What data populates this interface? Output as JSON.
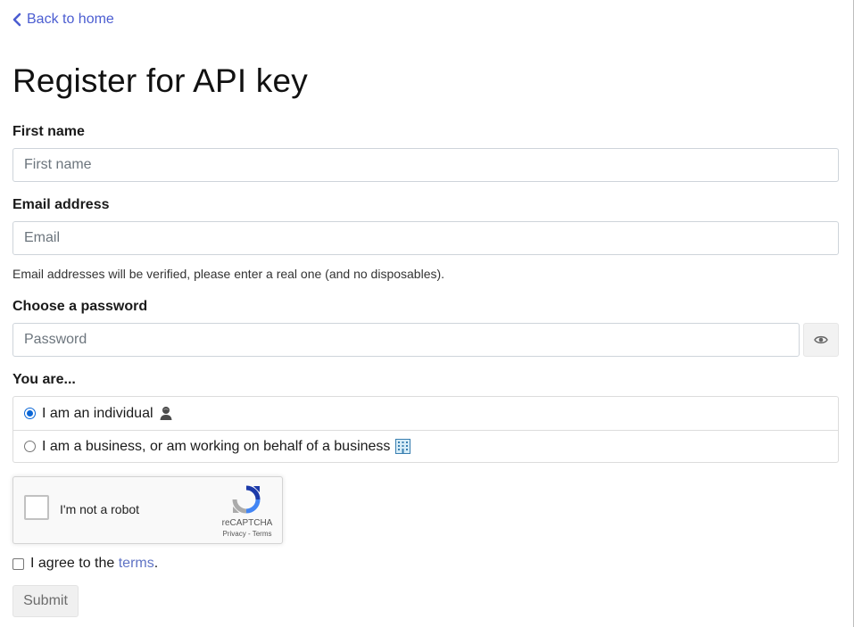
{
  "nav": {
    "back_label": "Back to home"
  },
  "page": {
    "title": "Register for API key"
  },
  "form": {
    "first_name": {
      "label": "First name",
      "placeholder": "First name",
      "value": ""
    },
    "email": {
      "label": "Email address",
      "placeholder": "Email",
      "value": "",
      "help": "Email addresses will be verified, please enter a real one (and no disposables)."
    },
    "password": {
      "label": "Choose a password",
      "placeholder": "Password",
      "value": "",
      "toggle_icon": "eye-icon"
    },
    "account_type": {
      "label": "You are...",
      "options": [
        {
          "label": "I am an individual",
          "selected": true,
          "icon": "person-icon"
        },
        {
          "label": "I am a business, or am working on behalf of a business",
          "selected": false,
          "icon": "office-building-icon"
        }
      ]
    },
    "recaptcha": {
      "label": "I'm not a robot",
      "brand": "reCAPTCHA",
      "links": "Privacy - Terms"
    },
    "agree": {
      "prefix": "I agree to the ",
      "link": "terms",
      "suffix": ".",
      "checked": false
    },
    "submit_label": "Submit"
  },
  "colors": {
    "link": "#4b5dd1",
    "radio_selected": "#0a66d6",
    "terms_link": "#5f73c4"
  }
}
